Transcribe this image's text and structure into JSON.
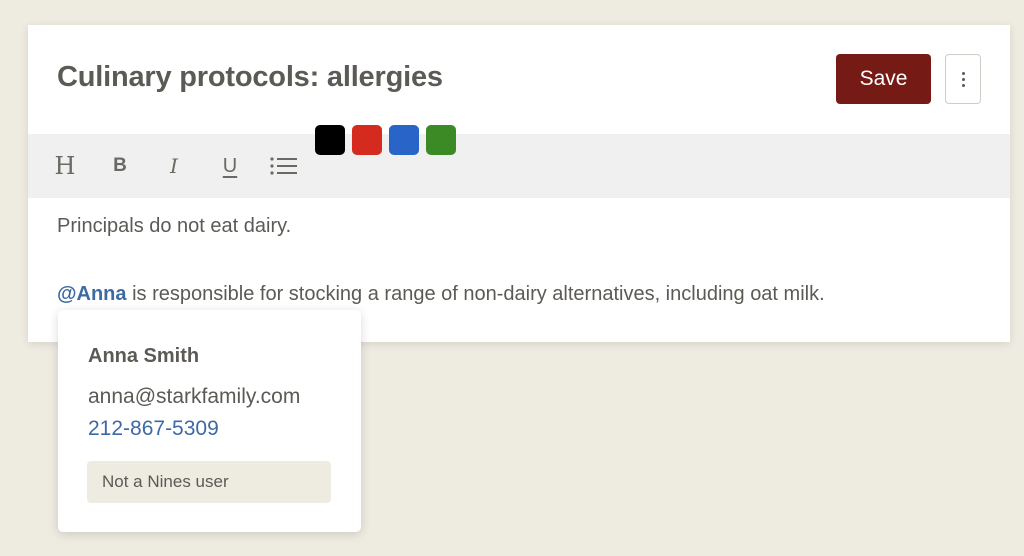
{
  "document": {
    "title": "Culinary protocols: allergies"
  },
  "header": {
    "save_label": "Save",
    "more_icon": "vertical-ellipsis-icon"
  },
  "toolbar": {
    "heading_glyph": "H",
    "bold_glyph": "B",
    "italic_glyph": "I",
    "underline_glyph": "U",
    "list_icon": "bulleted-list-icon",
    "colors": [
      {
        "name": "black",
        "hex": "#000000"
      },
      {
        "name": "red",
        "hex": "#d52b1e"
      },
      {
        "name": "blue",
        "hex": "#2965c8"
      },
      {
        "name": "green",
        "hex": "#3c8a25"
      }
    ]
  },
  "content": {
    "paragraph1": "Principals do not eat dairy.",
    "mention": "@Anna",
    "paragraph2_rest": " is responsible for stocking a range of non-dairy alternatives, including oat milk."
  },
  "popover": {
    "name": "Anna Smith",
    "email": "anna@starkfamily.com",
    "phone": "212-867-5309",
    "badge": "Not a Nines user"
  },
  "colors": {
    "background": "#eeebe1",
    "save_button": "#761a15",
    "link": "#3e6aa4",
    "text": "#5c5a55"
  }
}
